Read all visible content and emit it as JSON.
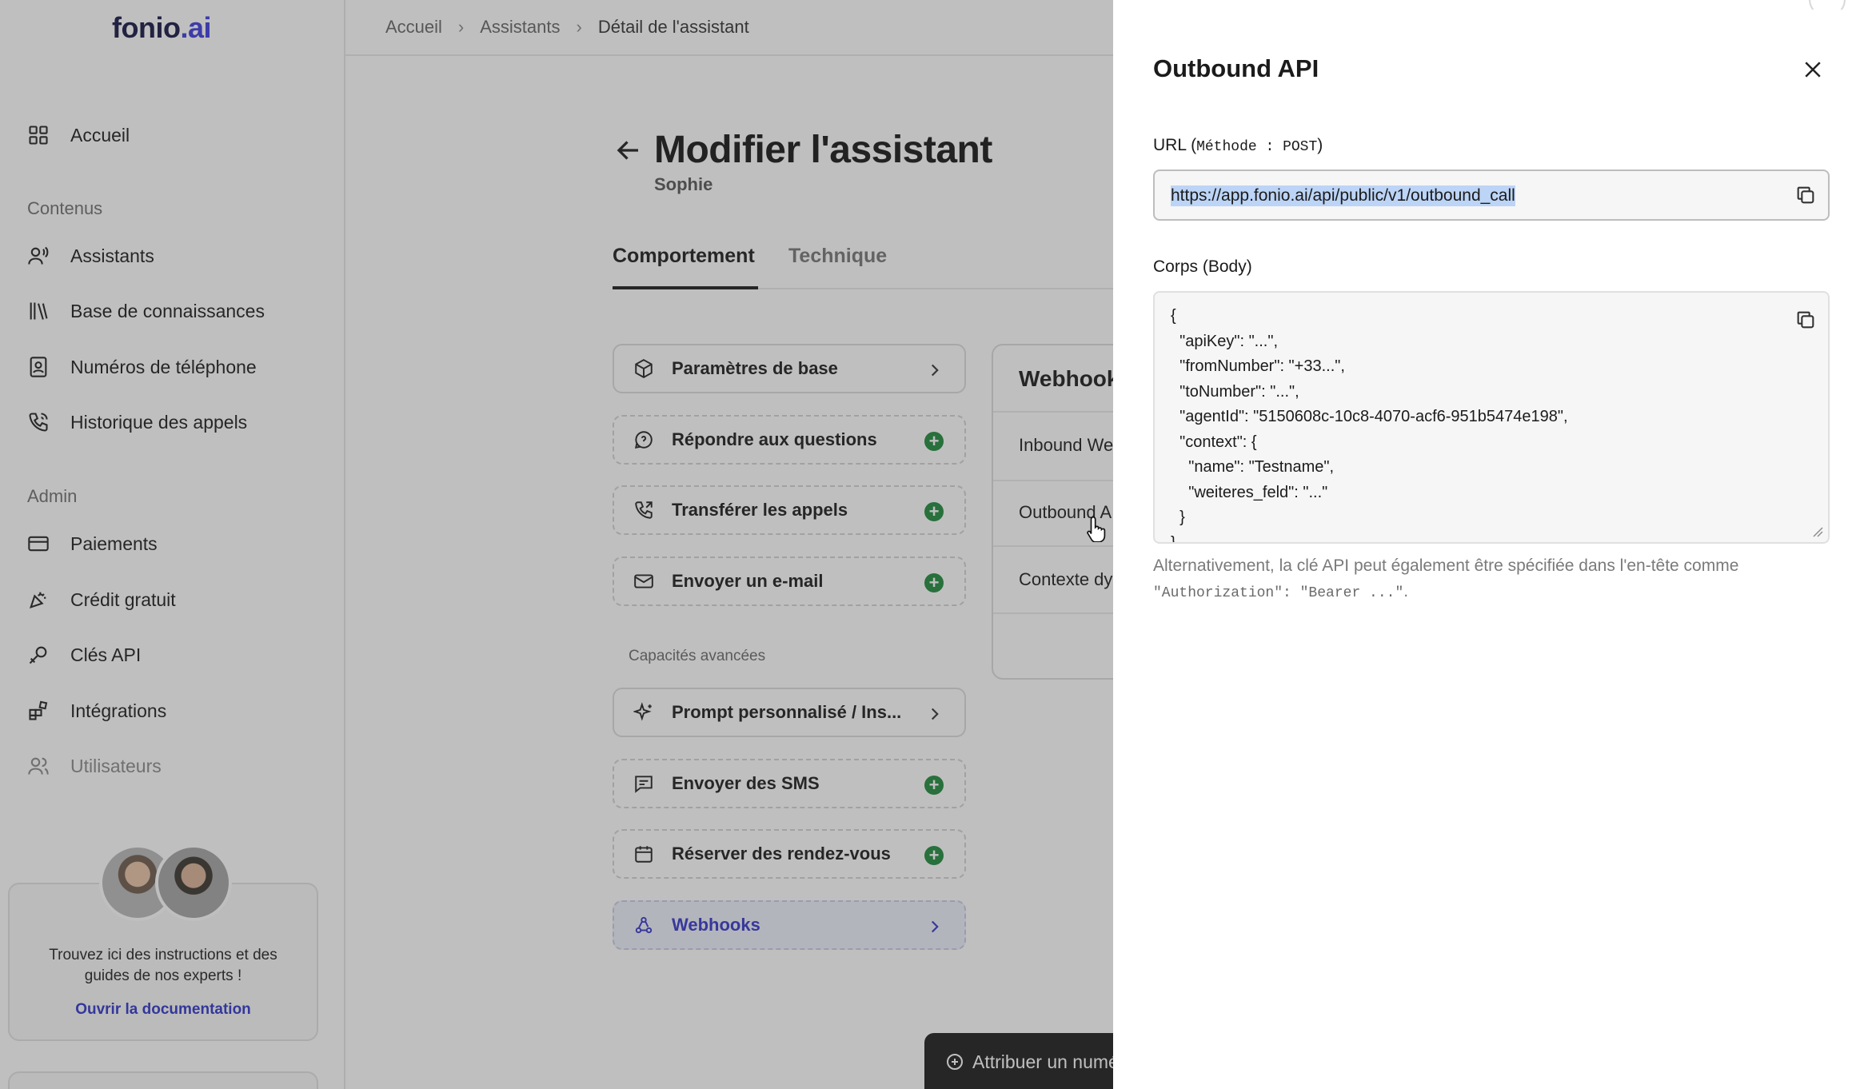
{
  "app": {
    "logo_main": "fonio",
    "logo_tld": ".ai"
  },
  "breadcrumb": {
    "items": [
      "Accueil",
      "Assistants",
      "Détail de l'assistant"
    ]
  },
  "sidebar": {
    "home": "Accueil",
    "section_content": "Contenus",
    "content_items": [
      {
        "label": "Assistants",
        "icon": "user-voice-icon"
      },
      {
        "label": "Base de connaissances",
        "icon": "library-icon"
      },
      {
        "label": "Numéros de téléphone",
        "icon": "phone-book-icon"
      },
      {
        "label": "Historique des appels",
        "icon": "phone-history-icon"
      }
    ],
    "section_admin": "Admin",
    "admin_items": [
      {
        "label": "Paiements",
        "icon": "credit-card-icon"
      },
      {
        "label": "Crédit gratuit",
        "icon": "confetti-icon"
      },
      {
        "label": "Clés API",
        "icon": "key-icon"
      },
      {
        "label": "Intégrations",
        "icon": "integrations-icon"
      },
      {
        "label": "Utilisateurs",
        "icon": "users-icon"
      }
    ],
    "help": {
      "text": "Trouvez ici des instructions et des guides de nos experts !",
      "link": "Ouvrir la documentation"
    }
  },
  "main": {
    "title": "Modifier l'assistant",
    "subtitle": "Sophie",
    "tabs": [
      {
        "label": "Comportement",
        "active": true
      },
      {
        "label": "Technique",
        "active": false
      }
    ],
    "capabilities": [
      {
        "label": "Paramètres de base",
        "style": "solid",
        "action": "chevron"
      },
      {
        "label": "Répondre aux questions",
        "style": "dashed",
        "action": "add"
      },
      {
        "label": "Transférer les appels",
        "style": "dashed",
        "action": "add"
      },
      {
        "label": "Envoyer un e-mail",
        "style": "dashed",
        "action": "add"
      }
    ],
    "advanced_label": "Capacités avancées",
    "advanced_capabilities": [
      {
        "label": "Prompt personnalisé / Ins...",
        "style": "solid",
        "action": "chevron"
      },
      {
        "label": "Envoyer des SMS",
        "style": "dashed",
        "action": "add"
      },
      {
        "label": "Réserver des rendez-vous",
        "style": "dashed",
        "action": "add"
      },
      {
        "label": "Webhooks",
        "style": "highlight",
        "action": "chevron"
      }
    ],
    "webhook_panel": {
      "title": "Webhooks",
      "rows": [
        "Inbound Webhook",
        "Outbound API",
        "Contexte dynamique"
      ]
    },
    "assign_button": "Attribuer un numéro"
  },
  "modal": {
    "title": "Outbound API",
    "url_label": "URL (",
    "url_method": "Méthode : POST",
    "url_label_end": ")",
    "url_value": "https://app.fonio.ai/api/public/v1/outbound_call",
    "body_label": "Corps (Body)",
    "body_code": "{\n  \"apiKey\": \"...\",\n  \"fromNumber\": \"+33...\",\n  \"toNumber\": \"...\",\n  \"agentId\": \"5150608c-10c8-4070-acf6-951b5474e198\",\n  \"context\": {\n    \"name\": \"Testname\",\n    \"weiteres_feld\": \"...\"\n  }\n}",
    "note_text": "Alternativement, la clé API peut également être spécifiée dans l'en-tête comme",
    "note_code": "\"Authorization\": \"Bearer ...\"",
    "note_end": "."
  },
  "colors": {
    "accent": "#3537c9",
    "add_green": "#1e8a3c",
    "selection": "#bcd4f6"
  }
}
